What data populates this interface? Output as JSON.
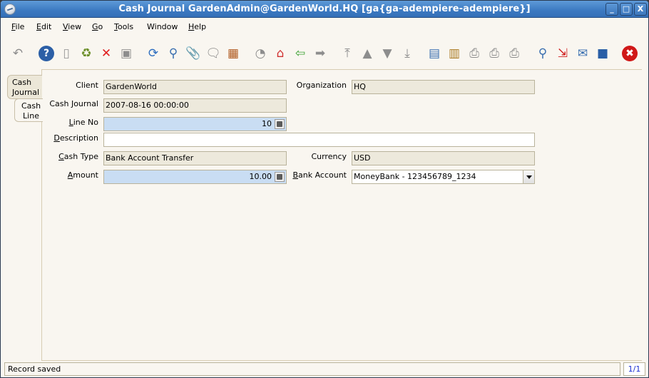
{
  "window": {
    "title": "Cash Journal  GardenAdmin@GardenWorld.HQ [ga{ga-adempiere-adempiere}]",
    "controls": {
      "minimize": "_",
      "maximize": "□",
      "close": "X"
    }
  },
  "menu": [
    {
      "label": "File",
      "mnemonic": "F",
      "rest": "ile"
    },
    {
      "label": "Edit",
      "mnemonic": "E",
      "rest": "dit"
    },
    {
      "label": "View",
      "mnemonic": "V",
      "rest": "iew"
    },
    {
      "label": "Go",
      "mnemonic": "G",
      "rest": "o"
    },
    {
      "label": "Tools",
      "mnemonic": "T",
      "rest": "ools"
    },
    {
      "label": "Window",
      "mnemonic": "",
      "rest": "Window"
    },
    {
      "label": "Help",
      "mnemonic": "H",
      "rest": "elp"
    }
  ],
  "toolbar": [
    {
      "name": "undo-icon",
      "glyph": "↶",
      "enabled": false
    },
    {
      "name": "help-icon",
      "glyph": "?",
      "enabled": true
    },
    {
      "name": "new-record-icon",
      "glyph": "▯",
      "enabled": true
    },
    {
      "name": "delete-icon",
      "glyph": "♻",
      "enabled": true
    },
    {
      "name": "delete-selection-icon",
      "glyph": "✕",
      "enabled": true
    },
    {
      "name": "save-icon",
      "glyph": "▣",
      "enabled": false
    },
    {
      "name": "refresh-icon",
      "glyph": "⟳",
      "enabled": true
    },
    {
      "name": "find-icon",
      "glyph": "⚲",
      "enabled": true
    },
    {
      "name": "attachment-icon",
      "glyph": "📎",
      "enabled": true
    },
    {
      "name": "chat-icon",
      "glyph": "🗨",
      "enabled": true
    },
    {
      "name": "grid-toggle-icon",
      "glyph": "▦",
      "enabled": true
    },
    {
      "name": "history-icon",
      "glyph": "◔",
      "enabled": false
    },
    {
      "name": "home-icon",
      "glyph": "⌂",
      "enabled": true
    },
    {
      "name": "parent-icon",
      "glyph": "⇦",
      "enabled": true
    },
    {
      "name": "detail-icon",
      "glyph": "➡",
      "enabled": false
    },
    {
      "name": "first-record-icon",
      "glyph": "⤒",
      "enabled": false
    },
    {
      "name": "previous-record-icon",
      "glyph": "▲",
      "enabled": false
    },
    {
      "name": "next-record-icon",
      "glyph": "▼",
      "enabled": false
    },
    {
      "name": "last-record-icon",
      "glyph": "⤓",
      "enabled": false
    },
    {
      "name": "report-icon",
      "glyph": "▤",
      "enabled": true
    },
    {
      "name": "archive-icon",
      "glyph": "▥",
      "enabled": true
    },
    {
      "name": "print-preview-icon",
      "glyph": "⎙",
      "enabled": false
    },
    {
      "name": "print-icon",
      "glyph": "⎙",
      "enabled": false
    },
    {
      "name": "batch-print-icon",
      "glyph": "⎙",
      "enabled": false
    },
    {
      "name": "zoom-across-icon",
      "glyph": "⚲",
      "enabled": true
    },
    {
      "name": "active-workflows-icon",
      "glyph": "⇲",
      "enabled": true
    },
    {
      "name": "request-icon",
      "glyph": "✉",
      "enabled": true
    },
    {
      "name": "product-info-icon",
      "glyph": "■",
      "enabled": true
    },
    {
      "name": "exit-icon",
      "glyph": "✖",
      "enabled": true
    }
  ],
  "tabs": [
    {
      "label_line1": "Cash",
      "label_line2": "Journal",
      "active": false
    },
    {
      "label_line1": "Cash",
      "label_line2": "Line",
      "active": true
    }
  ],
  "form": {
    "client": {
      "label": "Client",
      "value": "GardenWorld"
    },
    "organization": {
      "label": "Organization",
      "value": "HQ"
    },
    "cash_journal": {
      "label": "Cash Journal",
      "value": "2007-08-16 00:00:00"
    },
    "line_no": {
      "label_u": "L",
      "label_rest": "ine No",
      "value": "10"
    },
    "description": {
      "label_u": "D",
      "label_rest": "escription",
      "value": ""
    },
    "cash_type": {
      "label_u": "C",
      "label_rest": "ash Type",
      "value": "Bank Account Transfer"
    },
    "currency": {
      "label": "Currency",
      "value": "USD"
    },
    "amount": {
      "label_u": "A",
      "label_rest": "mount",
      "value": "10.00"
    },
    "bank_account": {
      "label_u": "B",
      "label_rest": "ank Account",
      "value": "MoneyBank - 123456789_1234"
    }
  },
  "status": {
    "message": "Record saved",
    "record_count": "1/1"
  }
}
